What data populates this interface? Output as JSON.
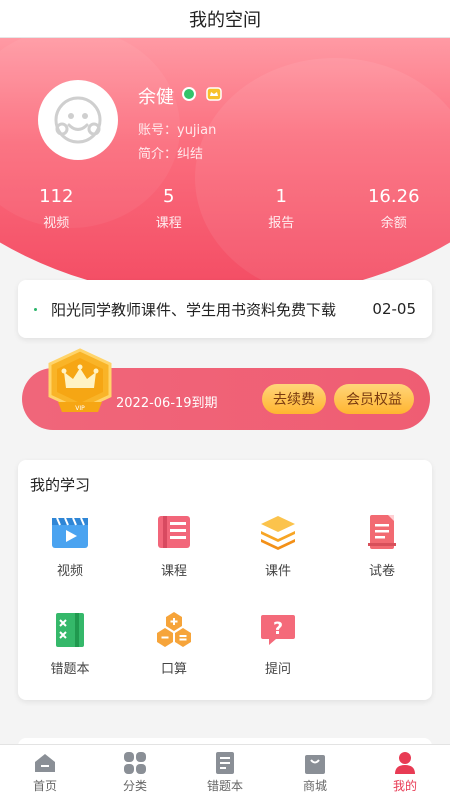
{
  "header": {
    "title": "我的空间"
  },
  "profile": {
    "name": "余健",
    "account": "账号：yujian",
    "intro": "简介：纠结"
  },
  "stats": [
    {
      "value": "112",
      "label": "视频"
    },
    {
      "value": "5",
      "label": "课程"
    },
    {
      "value": "1",
      "label": "报告"
    },
    {
      "value": "16.26",
      "label": "余额"
    }
  ],
  "notice": {
    "text": "阳光同学教师课件、学生用书资料免费下载",
    "date": "02-05"
  },
  "vip": {
    "badge_text": "VIP",
    "expire": "2022-06-19到期",
    "renew_label": "去续费",
    "rights_label": "会员权益"
  },
  "study": {
    "heading": "我的学习",
    "items": [
      {
        "label": "视频",
        "icon": "video-icon"
      },
      {
        "label": "课程",
        "icon": "course-icon"
      },
      {
        "label": "课件",
        "icon": "courseware-icon"
      },
      {
        "label": "试卷",
        "icon": "exam-paper-icon"
      },
      {
        "label": "错题本",
        "icon": "wrong-book-icon"
      },
      {
        "label": "口算",
        "icon": "mental-math-icon"
      },
      {
        "label": "提问",
        "icon": "question-icon"
      }
    ]
  },
  "tabbar": {
    "items": [
      {
        "label": "首页",
        "icon": "home-icon"
      },
      {
        "label": "分类",
        "icon": "category-icon"
      },
      {
        "label": "错题本",
        "icon": "notebook-icon"
      },
      {
        "label": "商城",
        "icon": "shop-icon"
      },
      {
        "label": "我的",
        "icon": "user-icon"
      }
    ],
    "active": "我的"
  },
  "colors": {
    "accent": "#f34a62",
    "vip_gold": "#ffb530",
    "active_tab": "#e83b54"
  }
}
